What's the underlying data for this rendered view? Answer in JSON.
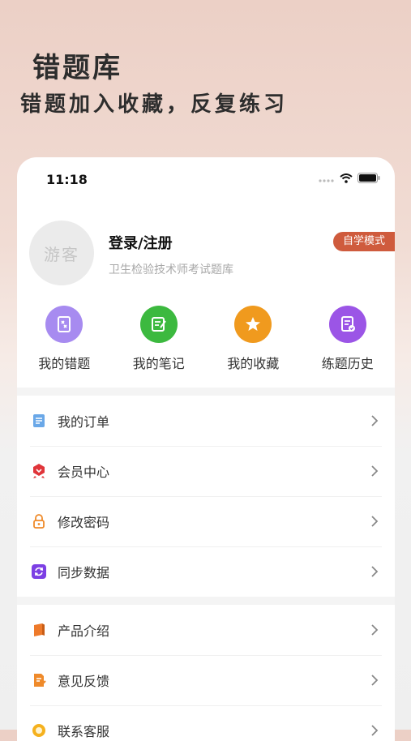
{
  "promo": {
    "title": "错题库",
    "subtitle": "错题加入收藏，反复练习"
  },
  "status_bar": {
    "time": "11:18",
    "icons": [
      "signal-icon",
      "wifi-icon",
      "battery-icon"
    ]
  },
  "profile": {
    "avatar_text": "游客",
    "login_label": "登录/注册",
    "app_subtitle": "卫生检验技术师考试题库",
    "mode_badge": "自学模式"
  },
  "quick_actions": [
    {
      "label": "我的错题",
      "icon": "wrong-questions-icon",
      "color": "#a78bf0"
    },
    {
      "label": "我的笔记",
      "icon": "notes-icon",
      "color": "#3cb93f"
    },
    {
      "label": "我的收藏",
      "icon": "star-icon",
      "color": "#f09a1e"
    },
    {
      "label": "练题历史",
      "icon": "history-icon",
      "color": "#9b55e6"
    }
  ],
  "menu_group_1": [
    {
      "label": "我的订单",
      "icon": "order-icon"
    },
    {
      "label": "会员中心",
      "icon": "vip-icon"
    },
    {
      "label": "修改密码",
      "icon": "lock-icon"
    },
    {
      "label": "同步数据",
      "icon": "sync-icon"
    }
  ],
  "menu_group_2": [
    {
      "label": "产品介绍",
      "icon": "book-icon"
    },
    {
      "label": "意见反馈",
      "icon": "feedback-icon"
    },
    {
      "label": "联系客服",
      "icon": "service-icon"
    }
  ],
  "colors": {
    "accent": "#cf5b3d",
    "background_top": "#ecd0c6"
  }
}
